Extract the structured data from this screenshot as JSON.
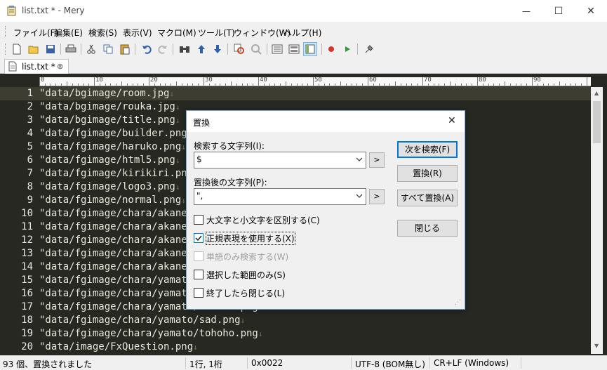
{
  "window": {
    "title": "list.txt * - Mery",
    "minimize_glyph": "—",
    "maximize_glyph": "☐",
    "close_glyph": "✕"
  },
  "menu": [
    {
      "label": "ファイル(F)"
    },
    {
      "label": "編集(E)"
    },
    {
      "label": "検索(S)"
    },
    {
      "label": "表示(V)"
    },
    {
      "label": "マクロ(M)"
    },
    {
      "label": "ツール(T)"
    },
    {
      "label": "ウィンドウ(W)"
    },
    {
      "label": "ヘルプ(H)"
    }
  ],
  "toolbar": {
    "icons": [
      "new-file-icon",
      "open-folder-icon",
      "save-icon",
      "print-icon",
      "cut-icon",
      "copy-icon",
      "paste-icon",
      "undo-icon",
      "redo-icon",
      "find-icon",
      "find-prev-icon",
      "find-next-icon",
      "replace-icon",
      "clear-highlight-icon",
      "outline-icon",
      "wrap-icon",
      "tab-view-icon",
      "record-macro-icon",
      "run-macro-icon",
      "plugin-icon"
    ]
  },
  "tab": {
    "label": "list.txt *",
    "pin_glyph": "⊗"
  },
  "ruler": {
    "labels": [
      "0",
      "10",
      "20",
      "30",
      "40",
      "50",
      "60",
      "70",
      "80",
      "90"
    ]
  },
  "editor": {
    "lines": [
      {
        "num": "1",
        "text": "\"data/bgimage/room.jpg"
      },
      {
        "num": "2",
        "text": "\"data/bgimage/rouka.jpg"
      },
      {
        "num": "3",
        "text": "\"data/bgimage/title.png"
      },
      {
        "num": "4",
        "text": "\"data/fgimage/builder.png"
      },
      {
        "num": "5",
        "text": "\"data/fgimage/haruko.png"
      },
      {
        "num": "6",
        "text": "\"data/fgimage/html5.png"
      },
      {
        "num": "7",
        "text": "\"data/fgimage/kirikiri.png"
      },
      {
        "num": "8",
        "text": "\"data/fgimage/logo3.png"
      },
      {
        "num": "9",
        "text": "\"data/fgimage/normal.png"
      },
      {
        "num": "10",
        "text": "\"data/fgimage/chara/akane/a"
      },
      {
        "num": "11",
        "text": "\"data/fgimage/chara/akane/c"
      },
      {
        "num": "12",
        "text": "\"data/fgimage/chara/akane/h"
      },
      {
        "num": "13",
        "text": "\"data/fgimage/chara/akane/n"
      },
      {
        "num": "14",
        "text": "\"data/fgimage/chara/akane/s"
      },
      {
        "num": "15",
        "text": "\"data/fgimage/chara/yamato/"
      },
      {
        "num": "16",
        "text": "\"data/fgimage/chara/yamato/"
      },
      {
        "num": "17",
        "text": "\"data/fgimage/chara/yamato/normal.png"
      },
      {
        "num": "18",
        "text": "\"data/fgimage/chara/yamato/sad.png"
      },
      {
        "num": "19",
        "text": "\"data/fgimage/chara/yamato/tohoho.png"
      },
      {
        "num": "20",
        "text": "\"data/image/FxQuestion.png"
      }
    ],
    "eol_glyph": "↓"
  },
  "status": {
    "message": "93 個、置換されました",
    "position": "1行, 1桁",
    "code": "0x0022",
    "encoding": "UTF-8 (BOM無し)",
    "line_ending": "CR+LF (Windows)"
  },
  "dialog": {
    "title": "置換",
    "close_glyph": "✕",
    "find_label": "検索する文字列(I):",
    "find_value": "$",
    "replace_label": "置換後の文字列(P):",
    "replace_value": "\",",
    "arrow_button": ">",
    "find_next_button": "次を検索(F)",
    "replace_button": "置換(R)",
    "replace_all_button": "すべて置換(A)",
    "close_button": "閉じる",
    "options": [
      {
        "label": "大文字と小文字を区別する(C)",
        "checked": false,
        "disabled": false
      },
      {
        "label": "正規表現を使用する(X)",
        "checked": true,
        "disabled": false
      },
      {
        "label": "単語のみ検索する(W)",
        "checked": false,
        "disabled": true
      },
      {
        "label": "選択した範囲のみ(S)",
        "checked": false,
        "disabled": false
      },
      {
        "label": "終了したら閉じる(L)",
        "checked": false,
        "disabled": false
      }
    ]
  }
}
